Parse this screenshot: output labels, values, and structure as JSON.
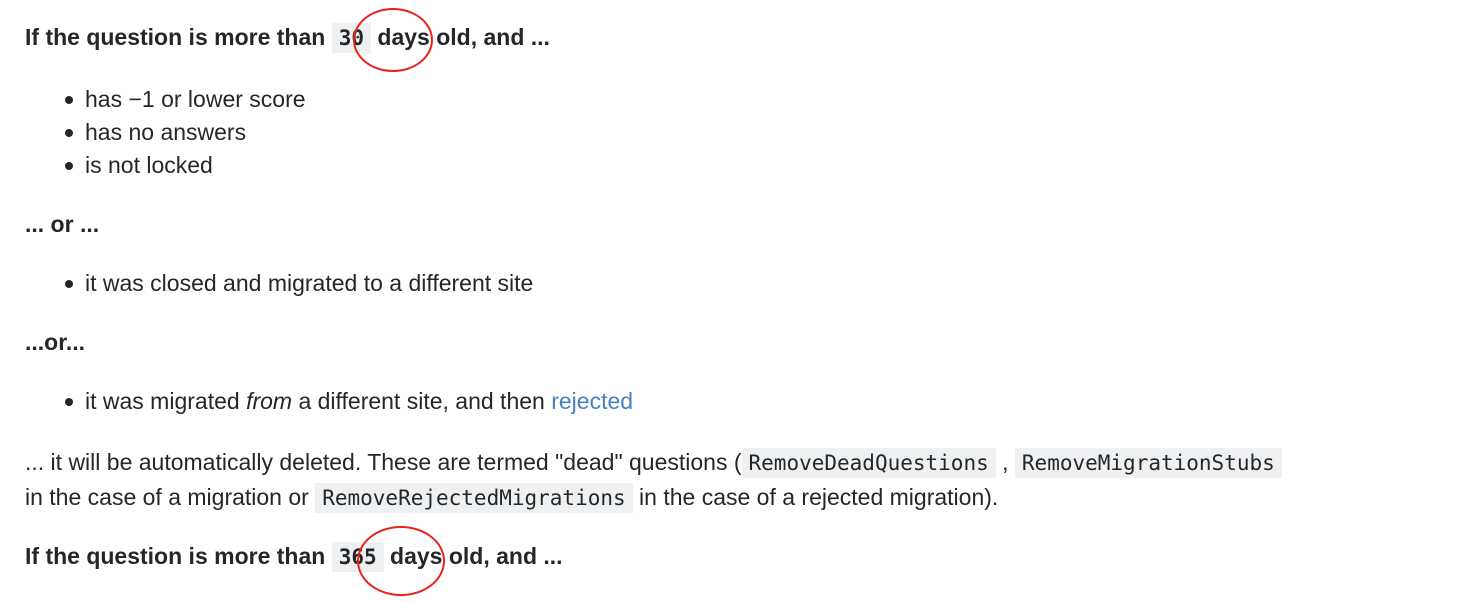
{
  "section1": {
    "heading_pre": "If the question is more than",
    "heading_days": "30",
    "heading_post": "days old, and ...",
    "bullets": [
      "has −1 or lower score",
      "has no answers",
      "is not locked"
    ]
  },
  "or1": "... or ...",
  "section2": {
    "bullets": [
      "it was closed and migrated to a different site"
    ]
  },
  "or2": "...or...",
  "section3": {
    "bullet_pre": "it was migrated",
    "bullet_em": "from",
    "bullet_mid": "a different site, and then",
    "bullet_link": "rejected"
  },
  "paragraph": {
    "t1": "... it will be automatically deleted. These are termed \"dead\" questions (",
    "code1": "RemoveDeadQuestions",
    "t2": ",",
    "code2": "RemoveMigrationStubs",
    "t3": "in the case of a migration or",
    "code3": "RemoveRejectedMigrations",
    "t4": "in the case of a rejected migration)."
  },
  "section4": {
    "heading_pre": "If the question is more than",
    "heading_days": "365",
    "heading_post": "days old, and ..."
  },
  "annotation_color": "#e8231b"
}
